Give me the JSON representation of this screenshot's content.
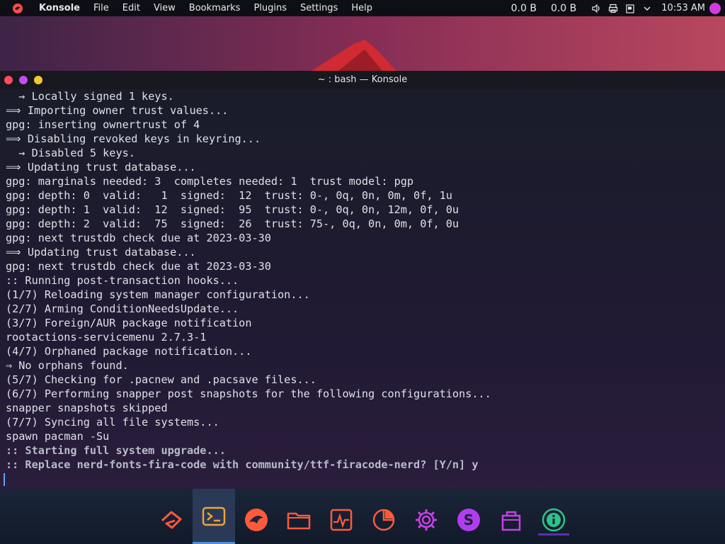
{
  "top_panel": {
    "app_name": "Konsole",
    "menu": [
      "File",
      "Edit",
      "View",
      "Bookmarks",
      "Plugins",
      "Settings",
      "Help"
    ],
    "net_down": "0.0 B",
    "net_up": "0.0 B",
    "clock": "10:53 AM",
    "tray_icons": [
      "volume-icon",
      "printer-icon",
      "clipboard-icon",
      "chevron-down-icon"
    ]
  },
  "window": {
    "title": "~ : bash — Konsole"
  },
  "terminal": {
    "lines": [
      {
        "text": "  → Locally signed 1 keys.",
        "bold": false
      },
      {
        "text": "⟹ Importing owner trust values...",
        "bold": false
      },
      {
        "text": "gpg: inserting ownertrust of 4",
        "bold": false
      },
      {
        "text": "⟹ Disabling revoked keys in keyring...",
        "bold": false
      },
      {
        "text": "  → Disabled 5 keys.",
        "bold": false
      },
      {
        "text": "⟹ Updating trust database...",
        "bold": false
      },
      {
        "text": "gpg: marginals needed: 3  completes needed: 1  trust model: pgp",
        "bold": false
      },
      {
        "text": "gpg: depth: 0  valid:   1  signed:  12  trust: 0-, 0q, 0n, 0m, 0f, 1u",
        "bold": false
      },
      {
        "text": "gpg: depth: 1  valid:  12  signed:  95  trust: 0-, 0q, 0n, 12m, 0f, 0u",
        "bold": false
      },
      {
        "text": "gpg: depth: 2  valid:  75  signed:  26  trust: 75-, 0q, 0n, 0m, 0f, 0u",
        "bold": false
      },
      {
        "text": "gpg: next trustdb check due at 2023-03-30",
        "bold": false
      },
      {
        "text": "⟹ Updating trust database...",
        "bold": false
      },
      {
        "text": "gpg: next trustdb check due at 2023-03-30",
        "bold": false
      },
      {
        "text": ":: Running post-transaction hooks...",
        "bold": false
      },
      {
        "text": "(1/7) Reloading system manager configuration...",
        "bold": false
      },
      {
        "text": "(2/7) Arming ConditionNeedsUpdate...",
        "bold": false
      },
      {
        "text": "(3/7) Foreign/AUR package notification",
        "bold": false
      },
      {
        "text": "rootactions-servicemenu 2.7.3-1",
        "bold": false
      },
      {
        "text": "(4/7) Orphaned package notification...",
        "bold": false
      },
      {
        "text": "⇒ No orphans found.",
        "bold": false
      },
      {
        "text": "(5/7) Checking for .pacnew and .pacsave files...",
        "bold": false
      },
      {
        "text": "(6/7) Performing snapper post snapshots for the following configurations...",
        "bold": false
      },
      {
        "text": "snapper snapshots skipped",
        "bold": false
      },
      {
        "text": "(7/7) Syncing all file systems...",
        "bold": false
      },
      {
        "text": "spawn pacman -Su",
        "bold": false
      },
      {
        "text": ":: Starting full system upgrade...",
        "bold": true
      },
      {
        "text": ":: Replace nerd-fonts-fira-code with community/ttf-firacode-nerd? [Y/n] y",
        "bold": true
      }
    ]
  },
  "dock": {
    "items": [
      "garuda-icon",
      "terminal-icon",
      "dragon-icon",
      "folder-icon",
      "system-monitor-icon",
      "disk-usage-icon",
      "settings-gear-icon",
      "s-app-icon",
      "package-store-icon",
      "info-icon"
    ]
  },
  "colors": {
    "close": "#ff4b5c",
    "maximize": "#c34cf0",
    "minimize": "#f3c82f",
    "dock_icon": "#ff5a3c",
    "accent": "#4d8ddb"
  }
}
